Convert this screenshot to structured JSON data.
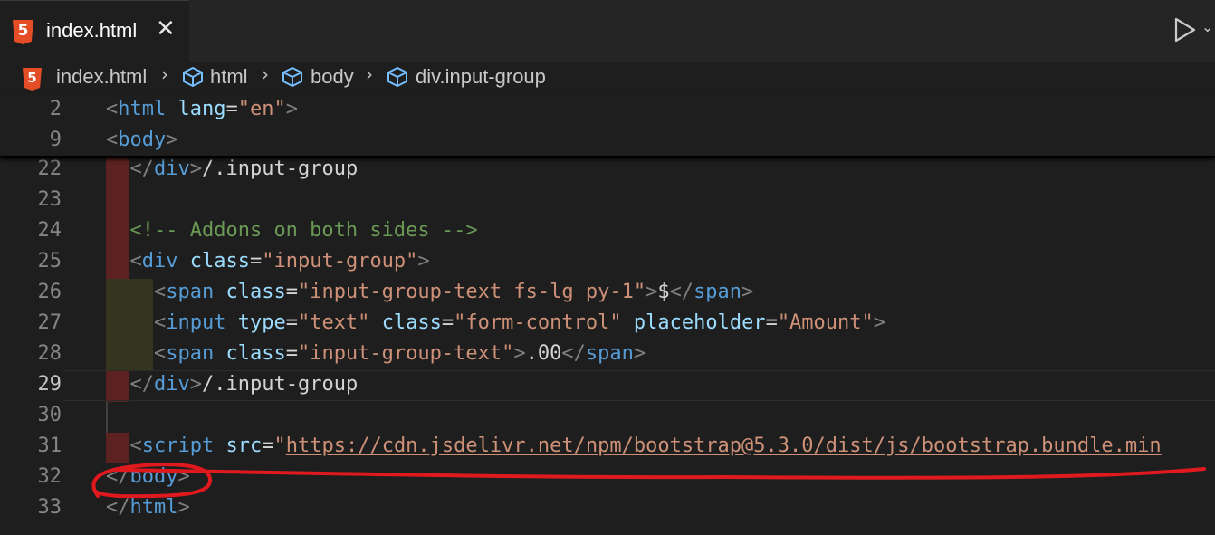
{
  "tab": {
    "title": "index.html",
    "close_glyph": "✕",
    "icon": "html5-icon"
  },
  "toolbar": {
    "run_icon": "play-icon",
    "more_glyph": "⌄"
  },
  "breadcrumb": [
    "index.html",
    "html",
    "body",
    "div.input-group"
  ],
  "sticky_lines": [
    {
      "num": "2",
      "tokens": [
        [
          "br",
          "<"
        ],
        [
          "tag",
          "html"
        ],
        [
          "plain",
          " "
        ],
        [
          "attr",
          "lang"
        ],
        [
          "eq",
          "="
        ],
        [
          "str",
          "\"en\""
        ],
        [
          "br",
          ">"
        ]
      ]
    },
    {
      "num": "9",
      "tokens": [
        [
          "br",
          "<"
        ],
        [
          "tag",
          "body"
        ],
        [
          "br",
          ">"
        ]
      ]
    }
  ],
  "lines": [
    {
      "num": "22",
      "tokens": [
        [
          "plain",
          "  "
        ],
        [
          "br",
          "</"
        ],
        [
          "tag",
          "div"
        ],
        [
          "br",
          ">"
        ],
        [
          "plain",
          "/.input-group"
        ]
      ]
    },
    {
      "num": "23",
      "tokens": []
    },
    {
      "num": "24",
      "tokens": [
        [
          "plain",
          "  "
        ],
        [
          "com",
          "<!-- Addons on both sides -->"
        ]
      ]
    },
    {
      "num": "25",
      "tokens": [
        [
          "plain",
          "  "
        ],
        [
          "br",
          "<"
        ],
        [
          "tag",
          "div"
        ],
        [
          "plain",
          " "
        ],
        [
          "attr",
          "class"
        ],
        [
          "eq",
          "="
        ],
        [
          "str",
          "\"input-group\""
        ],
        [
          "br",
          ">"
        ]
      ]
    },
    {
      "num": "26",
      "tokens": [
        [
          "plain",
          "    "
        ],
        [
          "br",
          "<"
        ],
        [
          "tag",
          "span"
        ],
        [
          "plain",
          " "
        ],
        [
          "attr",
          "class"
        ],
        [
          "eq",
          "="
        ],
        [
          "str",
          "\"input-group-text fs-lg py-1\""
        ],
        [
          "br",
          ">"
        ],
        [
          "plain",
          "$"
        ],
        [
          "br",
          "</"
        ],
        [
          "tag",
          "span"
        ],
        [
          "br",
          ">"
        ]
      ]
    },
    {
      "num": "27",
      "tokens": [
        [
          "plain",
          "    "
        ],
        [
          "br",
          "<"
        ],
        [
          "tag",
          "input"
        ],
        [
          "plain",
          " "
        ],
        [
          "attr",
          "type"
        ],
        [
          "eq",
          "="
        ],
        [
          "str",
          "\"text\""
        ],
        [
          "plain",
          " "
        ],
        [
          "attr",
          "class"
        ],
        [
          "eq",
          "="
        ],
        [
          "str",
          "\"form-control\""
        ],
        [
          "plain",
          " "
        ],
        [
          "attr",
          "placeholder"
        ],
        [
          "eq",
          "="
        ],
        [
          "str",
          "\"Amount\""
        ],
        [
          "br",
          ">"
        ]
      ]
    },
    {
      "num": "28",
      "tokens": [
        [
          "plain",
          "    "
        ],
        [
          "br",
          "<"
        ],
        [
          "tag",
          "span"
        ],
        [
          "plain",
          " "
        ],
        [
          "attr",
          "class"
        ],
        [
          "eq",
          "="
        ],
        [
          "str",
          "\"input-group-text\""
        ],
        [
          "br",
          ">"
        ],
        [
          "plain",
          ".00"
        ],
        [
          "br",
          "</"
        ],
        [
          "tag",
          "span"
        ],
        [
          "br",
          ">"
        ]
      ]
    },
    {
      "num": "29",
      "tokens": [
        [
          "plain",
          "  "
        ],
        [
          "br",
          "</"
        ],
        [
          "tag",
          "div"
        ],
        [
          "br",
          ">"
        ],
        [
          "plain",
          "/.input-group"
        ]
      ],
      "active": true
    },
    {
      "num": "30",
      "tokens": []
    },
    {
      "num": "31",
      "tokens": [
        [
          "plain",
          "  "
        ],
        [
          "br",
          "<"
        ],
        [
          "tag",
          "script"
        ],
        [
          "plain",
          " "
        ],
        [
          "attr",
          "src"
        ],
        [
          "eq",
          "="
        ],
        [
          "str",
          "\""
        ],
        [
          "link",
          "https://cdn.jsdelivr.net/npm/bootstrap@5.3.0/dist/js/bootstrap.bundle.min"
        ]
      ]
    },
    {
      "num": "32",
      "tokens": [
        [
          "br",
          "</"
        ],
        [
          "tag",
          "body"
        ],
        [
          "br",
          ">"
        ]
      ]
    },
    {
      "num": "33",
      "tokens": [
        [
          "br",
          "</"
        ],
        [
          "tag",
          "html"
        ],
        [
          "br",
          ">"
        ]
      ]
    }
  ],
  "colors": {
    "editor_bg": "#1e1e1e",
    "tag": "#569cd6",
    "attr": "#9cdcfe",
    "string": "#ce9178",
    "comment": "#6a9955",
    "annotation": "#e0191f"
  }
}
